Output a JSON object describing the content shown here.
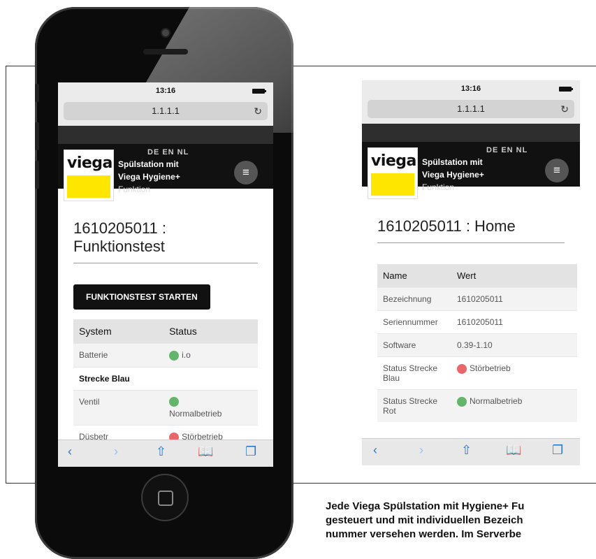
{
  "left_screen": {
    "time": "13:16",
    "url": "1.1.1.1",
    "brand": "viega",
    "languages": "DE  EN  NL",
    "site_title_line1": "Spülstation mit",
    "site_title_line2": "Viega Hygiene+",
    "site_title_line3": "Funktion",
    "page_title": "1610205011 : Funktionstest",
    "start_button": "FUNKTIONSTEST STARTEN",
    "table_headers": [
      "System",
      "Status"
    ],
    "rows": [
      {
        "label": "Batterie",
        "status": "i.o",
        "color": "green"
      },
      {
        "label": "Strecke Blau"
      },
      {
        "label": "Ventil",
        "status": "Normalbetrieb",
        "color": "green"
      },
      {
        "label": "Düsbetr",
        "status": "Störbetrieb",
        "color": "red"
      }
    ]
  },
  "right_screen": {
    "time": "13:16",
    "url": "1.1.1.1",
    "brand": "viega",
    "languages": "DE  EN  NL",
    "site_title_line1": "Spülstation mit",
    "site_title_line2": "Viega Hygiene+",
    "site_title_line3": "Funktion",
    "page_title": "1610205011 : Home",
    "table_headers": [
      "Name",
      "Wert"
    ],
    "rows": [
      {
        "label": "Bezeichnung",
        "value": "1610205011"
      },
      {
        "label": "Seriennummer",
        "value": "1610205011"
      },
      {
        "label": "Software",
        "value": "0.39-1.10"
      },
      {
        "label": "Status Strecke Blau",
        "value": "Störbetrieb",
        "color": "red"
      },
      {
        "label": "Status Strecke Rot",
        "value": "Normalbetrieb",
        "color": "green"
      }
    ]
  },
  "caption": [
    "Jede Viega Spülstation mit Hygiene+ Fu",
    "gesteuert und mit individuellen Bezeich",
    "nummer versehen werden. Im Serverbe"
  ],
  "icons": {
    "reload": "↻",
    "menu": "≡",
    "back": "‹",
    "forward": "›",
    "share": "⇧",
    "bookmarks": "📖",
    "tabs": "❐"
  },
  "colors": {
    "brand_yellow": "#ffe600",
    "status_green": "#62b56b",
    "status_red": "#e8676a",
    "link_blue": "#2a7ad1"
  }
}
